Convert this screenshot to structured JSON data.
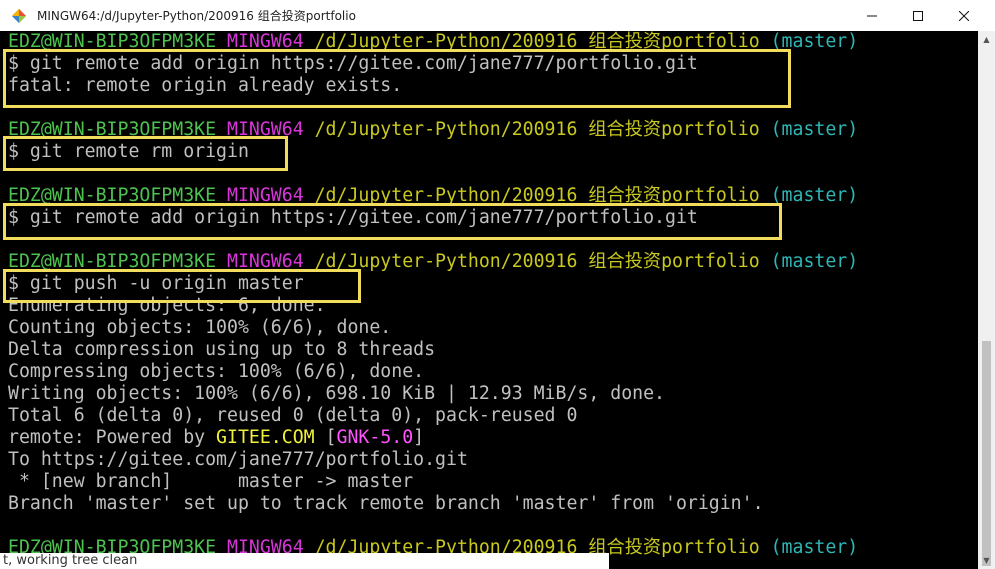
{
  "window": {
    "title": "MINGW64:/d/Jupyter-Python/200916 组合投资portfolio",
    "min_symbol": "—",
    "max_symbol": "☐",
    "close_symbol": "✕"
  },
  "prompt": {
    "user": "EDZ@WIN-BIP3OFPM3KE",
    "env": "MINGW64",
    "path": "/d/Jupyter-Python/200916 组合投资portfolio",
    "branch": "(master)"
  },
  "lines": {
    "cmd1": "$ git remote add origin https://gitee.com/jane777/portfolio.git",
    "out1": "fatal: remote origin already exists.",
    "cmd2": "$ git remote rm origin",
    "cmd3": "$ git remote add origin https://gitee.com/jane777/portfolio.git",
    "cmd4": "$ git push -u origin master",
    "out_enum": "Enumerating objects: 6, done.",
    "out_count": "Counting objects: 100% (6/6), done.",
    "out_delta": "Delta compression using up to 8 threads",
    "out_compress": "Compressing objects: 100% (6/6), done.",
    "out_write": "Writing objects: 100% (6/6), 698.10 KiB | 12.93 MiB/s, done.",
    "out_total": "Total 6 (delta 0), reused 0 (delta 0), pack-reused 0",
    "remote_prefix": "remote: Powered by ",
    "remote_gitee": "GITEE.COM",
    "remote_bracket_open": " [",
    "remote_gnk": "GNK-5.0",
    "remote_bracket_close": "]",
    "out_to": "To https://gitee.com/jane777/portfolio.git",
    "out_newbranch": " * [new branch]      master -> master",
    "out_track": "Branch 'master' set up to track remote branch 'master' from 'origin'."
  },
  "background_window": {
    "text": "t, working tree clean"
  },
  "colors": {
    "terminal_bg": "#000000",
    "highlight_box": "#f1dc5c",
    "prompt_user": "#4ec24e",
    "prompt_env": "#d936d9",
    "prompt_path": "#c8c81e",
    "prompt_branch": "#2fb6b6"
  }
}
